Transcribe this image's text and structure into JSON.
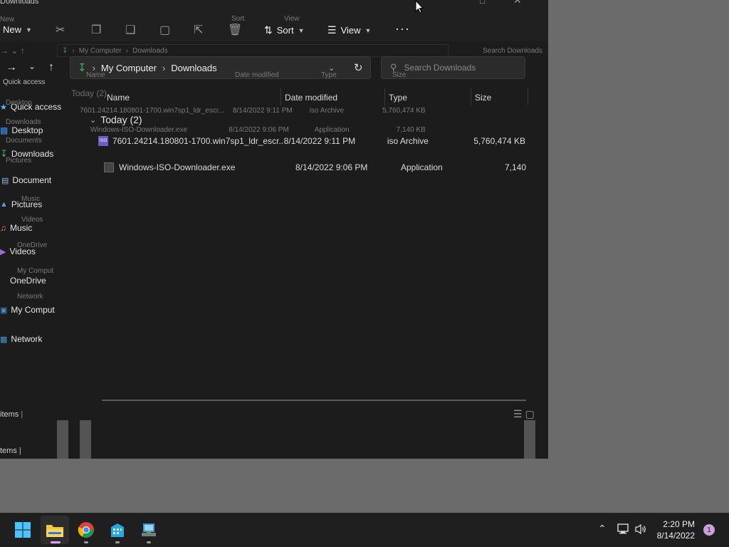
{
  "window": {
    "title": "Downloads",
    "ribbon": {
      "new_label": "New",
      "sort_label": "Sort",
      "view_label": "View",
      "more_label": "···"
    },
    "address": {
      "crumbs": [
        "My Computer",
        "Downloads"
      ],
      "ghost_crumbs": [
        "My Computer",
        "Downloads"
      ]
    },
    "search": {
      "placeholder": "Search Downloads"
    },
    "sidebar": {
      "quick_access": "Quick access",
      "items": [
        {
          "label": "Desktop"
        },
        {
          "label": "Downloads"
        },
        {
          "label": "Document"
        },
        {
          "label": "Pictures"
        },
        {
          "label": "Music"
        },
        {
          "label": "Videos"
        },
        {
          "label": "OneDrive"
        },
        {
          "label": "My Comput"
        },
        {
          "label": "Network"
        }
      ],
      "ghost_items": [
        "Quick access",
        "Desktop",
        "Downloads",
        "Documents",
        "Pictures",
        "Music",
        "Videos",
        "OneDrive",
        "My Comput",
        "Network"
      ]
    },
    "columns": {
      "name": "Name",
      "date": "Date modified",
      "type": "Type",
      "size": "Size"
    },
    "group": {
      "label": "Today (2)"
    },
    "files": [
      {
        "name": "7601.24214.180801-1700.win7sp1_ldr_escr...",
        "date": "8/14/2022 9:11 PM",
        "type": "iso Archive",
        "size": "5,760,474 KB"
      },
      {
        "name": "Windows-ISO-Downloader.exe",
        "date": "8/14/2022 9:06 PM",
        "type": "Application",
        "size": "7,140"
      }
    ],
    "ghost_files": [
      {
        "name": "7601.24214.180801-1700.win7sp1_ldr_escr...",
        "date": "8/14/2022 9:11 PM",
        "type": "iso Archive",
        "size": "5,760,474 KB"
      },
      {
        "name": "Windows-ISO-Downloader.exe",
        "date": "8/14/2022 9:06 PM",
        "type": "Application",
        "size": "7,140 KB"
      }
    ],
    "status": {
      "items": "items",
      "items2": "tems"
    }
  },
  "taskbar": {
    "time": "2:20 PM",
    "date": "8/14/2022",
    "notification_count": "1"
  },
  "colors": {
    "accent": "#4cc2ff",
    "folder": "#f4c542",
    "badge": "#c9a0dc"
  }
}
